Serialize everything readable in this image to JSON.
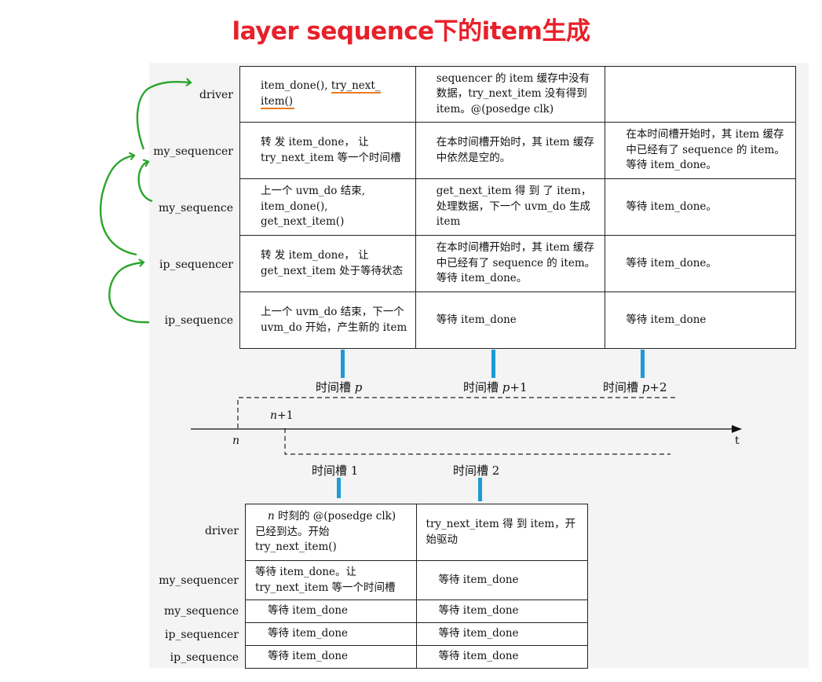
{
  "title": "layer sequence下的item生成",
  "top_table": {
    "rows": [
      "driver",
      "my_sequencer",
      "my_sequence",
      "ip_sequencer",
      "ip_sequence"
    ],
    "cells": [
      [
        "item_done(), try_next_item()",
        "sequencer 的 item 缓存中没有数据，try_next_item 没有得到 item。@(posedge clk)",
        ""
      ],
      [
        "转 发 item_done， 让 try_next_item 等一个时间槽",
        "在本时间槽开始时，其 item 缓存中依然是空的。",
        "在本时间槽开始时，其 item 缓存中已经有了 sequence 的 item。等待 item_done。"
      ],
      [
        "上一个 uvm_do 结束, item_done(), get_next_item()",
        "get_next_item 得 到 了 item，处理数据，下一个 uvm_do 生成 item",
        "等待 item_done。"
      ],
      [
        "转 发 item_done， 让 get_next_item 处于等待状态",
        "在本时间槽开始时，其 item 缓存中已经有了 sequence 的 item。等待 item_done。",
        "等待 item_done。"
      ],
      [
        "上一个 uvm_do 结束，下一个 uvm_do 开始，产生新的 item",
        "等待 item_done",
        "等待 item_done"
      ]
    ],
    "driver_cell_plain": "item_done(), ",
    "driver_cell_underlined": "try_next_",
    "driver_cell_tail": "item()"
  },
  "top_slots": [
    {
      "prefix": "时间槽 ",
      "var": "p",
      "suffix": ""
    },
    {
      "prefix": "时间槽 ",
      "var": "p",
      "suffix": "+1"
    },
    {
      "prefix": "时间槽 ",
      "var": "p",
      "suffix": "+2"
    }
  ],
  "timeline": {
    "n": "n",
    "n1_var": "n",
    "n1_suffix": "+1",
    "t": "t"
  },
  "bottom_slots": [
    "时间槽 1",
    "时间槽 2"
  ],
  "bottom_table": {
    "rows": [
      "driver",
      "my_sequencer",
      "my_sequence",
      "ip_sequencer",
      "ip_sequence"
    ],
    "driver_var": "n",
    "driver_text": " 时刻的 @(posedge clk) 已经到达。开始 try_next_item()",
    "cells": [
      [
        "",
        "try_next_item 得 到 item，开始驱动"
      ],
      [
        "等待 item_done。让 try_next_item 等一个时间槽",
        "等待 item_done"
      ],
      [
        "等待 item_done",
        "等待 item_done"
      ],
      [
        "等待 item_done",
        "等待 item_done"
      ],
      [
        "等待 item_done",
        "等待 item_done"
      ]
    ]
  },
  "colors": {
    "title": "#e8202a",
    "tick": "#1e9ad6",
    "arrow": "#2aa52a",
    "underline": "#ee7a1e"
  }
}
